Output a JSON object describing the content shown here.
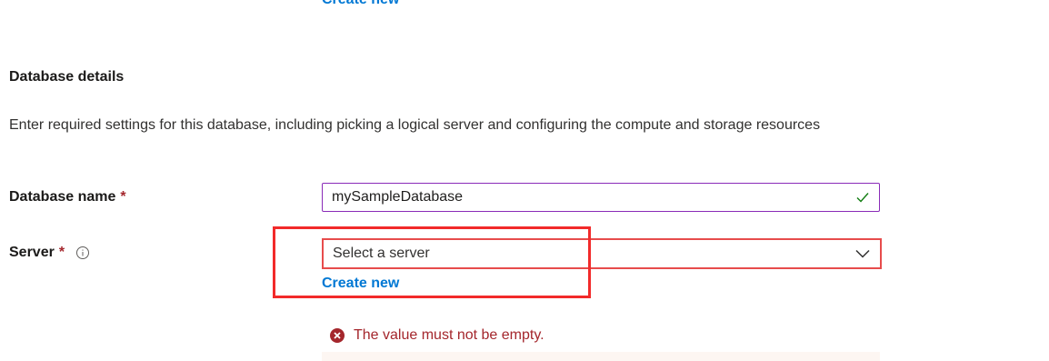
{
  "prev_section": {
    "create_new_link": "Create new"
  },
  "section": {
    "title": "Database details",
    "description": "Enter required settings for this database, including picking a logical server and configuring the compute and storage resources"
  },
  "database_name": {
    "label": "Database name",
    "required_marker": "*",
    "value": "mySampleDatabase",
    "valid_icon": "check-icon"
  },
  "server": {
    "label": "Server",
    "required_marker": "*",
    "info_icon": "info-icon",
    "placeholder": "Select a server",
    "dropdown_icon": "chevron-down-icon",
    "create_new_link": "Create new",
    "error_icon": "error-circle-icon",
    "error_message": "The value must not be empty."
  },
  "colors": {
    "link": "#0078d4",
    "required": "#a4262c",
    "input_focus_border": "#8a2bb8",
    "invalid_border": "#e74c4c",
    "highlight_box": "#f22a2a",
    "error_text": "#a4262c",
    "error_bg": "#fdf6f2"
  }
}
